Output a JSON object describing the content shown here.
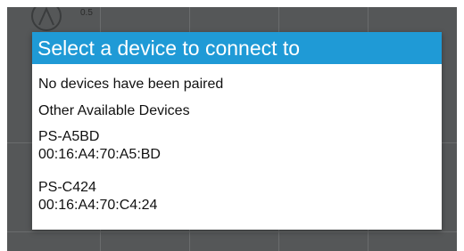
{
  "background": {
    "axis_tick_label": "0.5",
    "icon": "phone-outline-icon"
  },
  "dialog": {
    "title": "Select a device to connect to",
    "paired_status": "No devices have been paired",
    "available_header": "Other Available Devices",
    "devices": [
      {
        "name": "PS-A5BD",
        "address": "00:16:A4:70:A5:BD"
      },
      {
        "name": "PS-C424",
        "address": "00:16:A4:70:C4:24"
      }
    ]
  },
  "colors": {
    "title_bar": "#1f9ad6",
    "backdrop": "#555758"
  }
}
